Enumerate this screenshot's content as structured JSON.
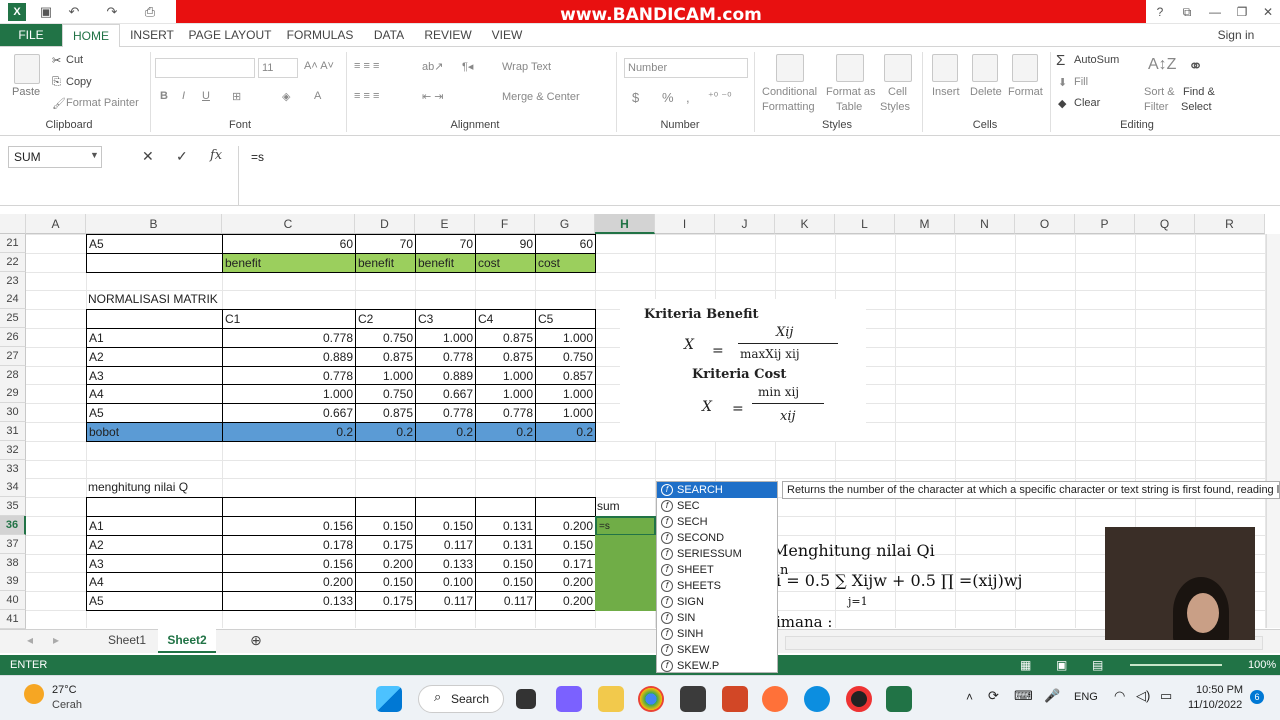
{
  "watermark": "www.BANDICAM.com",
  "title_buttons": {
    "help": "?",
    "restore": "⧉",
    "minimize": "—",
    "maximize": "❐",
    "close": "✕"
  },
  "tabs": {
    "file": "FILE",
    "home": "HOME",
    "insert": "INSERT",
    "page_layout": "PAGE LAYOUT",
    "formulas": "FORMULAS",
    "data": "DATA",
    "review": "REVIEW",
    "view": "VIEW",
    "sign_in": "Sign in"
  },
  "ribbon": {
    "clipboard": {
      "paste": "Paste",
      "cut": "Cut",
      "copy": "Copy",
      "format_painter": "Format Painter",
      "label": "Clipboard"
    },
    "font": {
      "size": "11",
      "label": "Font",
      "bold": "B",
      "italic": "I",
      "underline": "U"
    },
    "alignment": {
      "wrap": "Wrap Text",
      "merge": "Merge & Center",
      "label": "Alignment"
    },
    "number": {
      "format": "Number",
      "label": "Number",
      "currency": "$",
      "percent": "%",
      "comma": ","
    },
    "styles": {
      "conditional": "Conditional",
      "conditional2": "Formatting",
      "format_as": "Format as",
      "format_as2": "Table",
      "cell": "Cell",
      "cell2": "Styles",
      "label": "Styles"
    },
    "cells": {
      "insert": "Insert",
      "delete": "Delete",
      "format": "Format",
      "label": "Cells"
    },
    "editing": {
      "autosum": "AutoSum",
      "fill": "Fill",
      "clear": "Clear",
      "sort": "Sort &",
      "sort2": "Filter",
      "find": "Find &",
      "find2": "Select",
      "label": "Editing"
    }
  },
  "namebox": "SUM",
  "formula": "=s",
  "columns": [
    "A",
    "B",
    "C",
    "D",
    "E",
    "F",
    "G",
    "H",
    "I",
    "J",
    "K",
    "L",
    "M",
    "N",
    "O",
    "P",
    "Q",
    "R"
  ],
  "rows": [
    "21",
    "22",
    "23",
    "24",
    "25",
    "26",
    "27",
    "28",
    "29",
    "30",
    "31",
    "32",
    "33",
    "34",
    "35",
    "36",
    "37",
    "38",
    "39",
    "40",
    "41"
  ],
  "sheet": {
    "r21": {
      "b": "A5",
      "c": "60",
      "d": "70",
      "e": "70",
      "f": "90",
      "g": "60"
    },
    "r22": {
      "c": "benefit",
      "d": "benefit",
      "e": "benefit",
      "f": "cost",
      "g": "cost"
    },
    "r24": {
      "b": "NORMALISASI MATRIK"
    },
    "r25": {
      "c": "C1",
      "d": "C2",
      "e": "C3",
      "f": "C4",
      "g": "C5"
    },
    "norm": [
      {
        "b": "A1",
        "c": "0.778",
        "d": "0.750",
        "e": "1.000",
        "f": "0.875",
        "g": "1.000"
      },
      {
        "b": "A2",
        "c": "0.889",
        "d": "0.875",
        "e": "0.778",
        "f": "0.875",
        "g": "0.750"
      },
      {
        "b": "A3",
        "c": "0.778",
        "d": "1.000",
        "e": "0.889",
        "f": "1.000",
        "g": "0.857"
      },
      {
        "b": "A4",
        "c": "1.000",
        "d": "0.750",
        "e": "0.667",
        "f": "1.000",
        "g": "1.000"
      },
      {
        "b": "A5",
        "c": "0.667",
        "d": "0.875",
        "e": "0.778",
        "f": "0.778",
        "g": "1.000"
      }
    ],
    "r31": {
      "b": "bobot",
      "c": "0.2",
      "d": "0.2",
      "e": "0.2",
      "f": "0.2",
      "g": "0.2"
    },
    "r34": {
      "b": "menghitung nilai Q"
    },
    "r35": {
      "h": "sum"
    },
    "q": [
      {
        "b": "A1",
        "c": "0.156",
        "d": "0.150",
        "e": "0.150",
        "f": "0.131",
        "g": "0.200",
        "h": "=s"
      },
      {
        "b": "A2",
        "c": "0.178",
        "d": "0.175",
        "e": "0.117",
        "f": "0.131",
        "g": "0.150",
        "h": ""
      },
      {
        "b": "A3",
        "c": "0.156",
        "d": "0.200",
        "e": "0.133",
        "f": "0.150",
        "g": "0.171",
        "h": ""
      },
      {
        "b": "A4",
        "c": "0.200",
        "d": "0.150",
        "e": "0.100",
        "f": "0.150",
        "g": "0.200",
        "h": ""
      },
      {
        "b": "A5",
        "c": "0.133",
        "d": "0.175",
        "e": "0.117",
        "f": "0.117",
        "g": "0.200",
        "h": ""
      }
    ]
  },
  "formula_image": {
    "benefit": "Kriteria Benefit",
    "xij": "X",
    "num1": "Xij",
    "den1": "maxXij  xij",
    "cost": "Kriteria Cost",
    "num2": "min xij",
    "den2": "xij"
  },
  "autocomplete": [
    "SEARCH",
    "SEC",
    "SECH",
    "SECOND",
    "SERIESSUM",
    "SHEET",
    "SHEETS",
    "SIGN",
    "SIN",
    "SINH",
    "SKEW",
    "SKEW.P"
  ],
  "tooltip": "Returns the number of the character at which a specific character or text string is first found, reading left to right",
  "qi_image": {
    "title": "Menghitung nilai Qi",
    "formula": "i = 0.5 ∑ Xijw + 0.5 ∏ =(xij)wj",
    "lower": "j=1",
    "upper": "n",
    "dimana": "imana :"
  },
  "sheet_tabs": [
    "Sheet1",
    "Sheet2"
  ],
  "status": {
    "mode": "ENTER",
    "zoom": "100%"
  },
  "taskbar": {
    "temp": "27°C",
    "weather": "Cerah",
    "search": "Search",
    "lang": "ENG",
    "time": "10:50 PM",
    "date": "11/10/2022",
    "badge": "6"
  }
}
